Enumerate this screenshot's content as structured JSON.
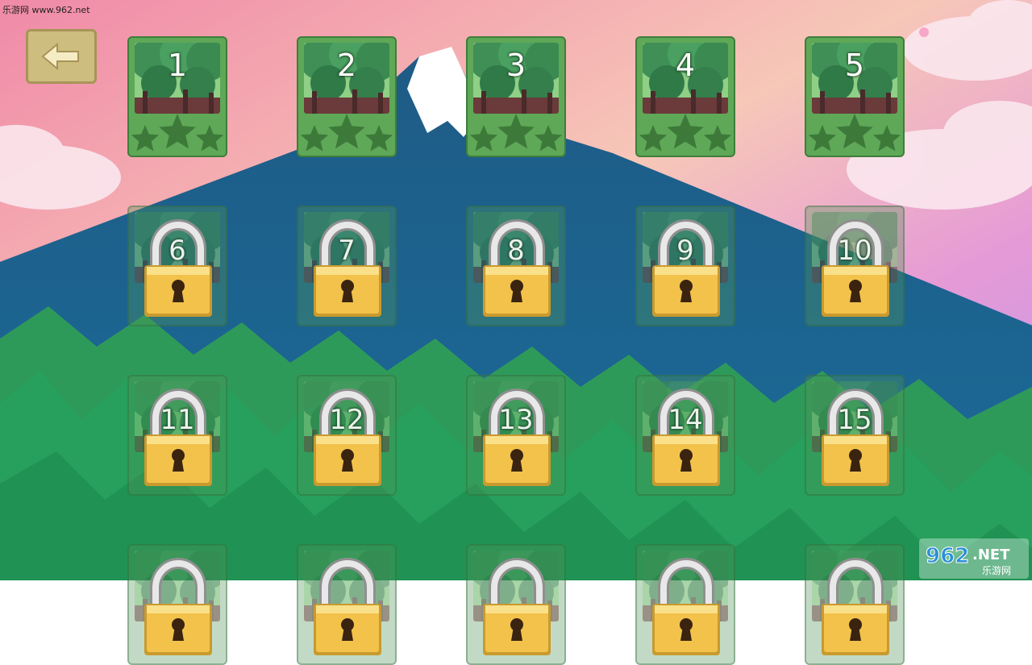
{
  "watermark": {
    "top_text": "乐游网 www.962.net",
    "logo_number": "962",
    "logo_suffix": ".NET",
    "logo_subtitle": "乐游网"
  },
  "back_button": {
    "icon": "arrow-left-icon"
  },
  "levels": [
    {
      "label": "1",
      "locked": false,
      "stars": 3
    },
    {
      "label": "2",
      "locked": false,
      "stars": 3
    },
    {
      "label": "3",
      "locked": false,
      "stars": 3
    },
    {
      "label": "4",
      "locked": false,
      "stars": 3
    },
    {
      "label": "5",
      "locked": false,
      "stars": 3
    },
    {
      "label": "6",
      "locked": true
    },
    {
      "label": "7",
      "locked": true
    },
    {
      "label": "8",
      "locked": true
    },
    {
      "label": "9",
      "locked": true
    },
    {
      "label": "10",
      "locked": true
    },
    {
      "label": "11",
      "locked": true
    },
    {
      "label": "12",
      "locked": true
    },
    {
      "label": "13",
      "locked": true
    },
    {
      "label": "14",
      "locked": true
    },
    {
      "label": "15",
      "locked": true
    },
    {
      "label": "",
      "locked": true
    },
    {
      "label": "",
      "locked": true
    },
    {
      "label": "",
      "locked": true
    },
    {
      "label": "",
      "locked": true
    },
    {
      "label": "",
      "locked": true
    }
  ],
  "colors": {
    "card_unlocked": "#5fa857",
    "star_dark": "#3d7a3a",
    "lock_gold": "#f2c24b",
    "mountain": "#1d5f8f"
  }
}
